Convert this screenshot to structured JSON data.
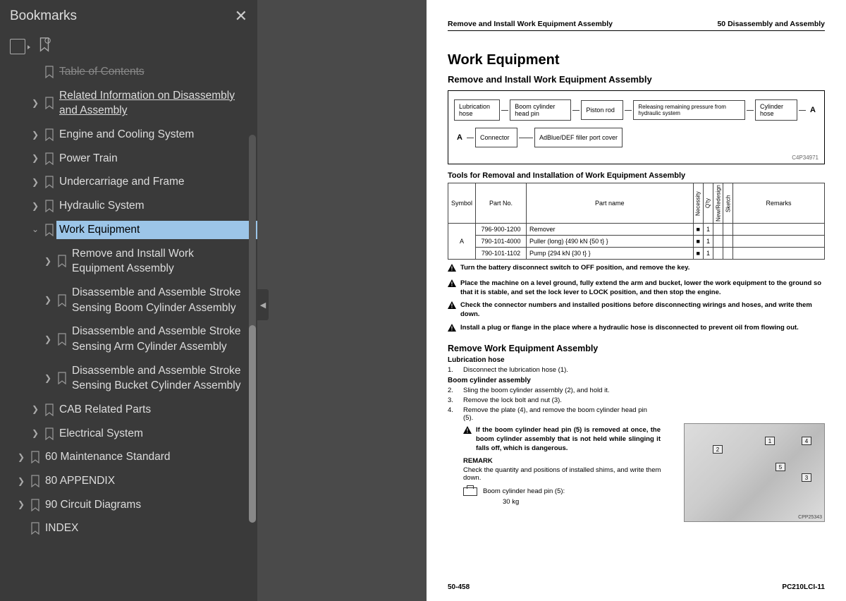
{
  "sidebar": {
    "title": "Bookmarks",
    "items": [
      {
        "txt": "Table of Contents",
        "lvl": 2,
        "chev": "",
        "style": "cut"
      },
      {
        "txt": "Related Information on Disassembly and Assembly",
        "lvl": 2,
        "chev": "r",
        "style": "under",
        "multi": true
      },
      {
        "txt": "Engine and Cooling System",
        "lvl": 2,
        "chev": "r"
      },
      {
        "txt": "Power Train",
        "lvl": 2,
        "chev": "r"
      },
      {
        "txt": "Undercarriage and Frame",
        "lvl": 2,
        "chev": "r"
      },
      {
        "txt": "Hydraulic System",
        "lvl": 2,
        "chev": "r"
      },
      {
        "txt": "Work Equipment",
        "lvl": 2,
        "chev": "d",
        "style": "sel"
      },
      {
        "txt": "Remove and Install Work Equipment Assembly",
        "lvl": 3,
        "chev": "r",
        "multi": true
      },
      {
        "txt": "Disassemble and Assemble Stroke Sensing Boom Cylinder Assembly",
        "lvl": 3,
        "chev": "r",
        "multi": true
      },
      {
        "txt": "Disassemble and Assemble Stroke Sensing Arm Cylinder Assembly",
        "lvl": 3,
        "chev": "r",
        "multi": true
      },
      {
        "txt": "Disassemble and Assemble Stroke Sensing Bucket Cylinder Assembly",
        "lvl": 3,
        "chev": "r",
        "multi": true
      },
      {
        "txt": "CAB Related Parts",
        "lvl": 2,
        "chev": "r"
      },
      {
        "txt": "Electrical System",
        "lvl": 2,
        "chev": "r"
      },
      {
        "txt": "60 Maintenance Standard",
        "lvl": 1,
        "chev": "r"
      },
      {
        "txt": "80 APPENDIX",
        "lvl": 1,
        "chev": "r"
      },
      {
        "txt": "90 Circuit Diagrams",
        "lvl": 1,
        "chev": "r"
      },
      {
        "txt": "INDEX",
        "lvl": 1,
        "chev": ""
      }
    ]
  },
  "page": {
    "hdr_l": "Remove and Install Work Equipment Assembly",
    "hdr_r": "50 Disassembly and Assembly",
    "h1": "Work Equipment",
    "h2": "Remove and Install Work Equipment Assembly",
    "diag": {
      "r1": [
        "Lubrication hose",
        "Boom cylinder head pin",
        "Piston rod",
        "Releasing remaining pressure from hydraulic system",
        "Cylinder hose"
      ],
      "r2": [
        "Connector",
        "AdBlue/DEF filler port cover"
      ],
      "code": "C4P34971"
    },
    "h3": "Tools for Removal and Installation of Work Equipment Assembly",
    "thead": [
      "Symbol",
      "Part No.",
      "Part name",
      "Necessity",
      "Q'ty",
      "New/Redesign",
      "Sketch",
      "Remarks"
    ],
    "trows": [
      {
        "sym": "",
        "pn": "796-900-1200",
        "name": "Remover",
        "nec": "■",
        "qty": "1"
      },
      {
        "sym": "A",
        "pn": "790-101-4000",
        "name": "Puller (long) {490 kN {50 t} }",
        "nec": "■",
        "qty": "1"
      },
      {
        "sym": "",
        "pn": "790-101-1102",
        "name": "Pump {294 kN {30 t} }",
        "nec": "■",
        "qty": "1"
      }
    ],
    "warns": [
      "Turn the battery disconnect switch to OFF position, and remove the key.",
      "Place the machine on a level ground, fully extend the arm and bucket, lower the work equipment to the ground so that it is stable, and set the lock lever to LOCK position, and then stop the engine.",
      "Check the connector numbers and installed positions before disconnecting wirings and hoses, and write them down.",
      "Install a plug or flange in the place where a hydraulic hose is disconnected to prevent oil from flowing out."
    ],
    "h4": "Remove Work Equipment Assembly",
    "sec1": {
      "t": "Lubrication hose",
      "s1": "Disconnect the lubrication hose (1)."
    },
    "sec2": {
      "t": "Boom cylinder assembly",
      "s2": "Sling the boom cylinder assembly (2), and hold it.",
      "s3": "Remove the lock bolt and nut (3).",
      "s4": "Remove the plate (4), and remove the boom cylinder head pin (5).",
      "warn": "If the boom cylinder head pin (5) is removed at once, the boom cylinder assembly that is not held while slinging it falls off, which is dangerous.",
      "remark": "REMARK",
      "rtxt": "Check the quantity and positions of installed shims, and write them down.",
      "wlabel": "Boom cylinder head pin (5):",
      "wval": "30 kg"
    },
    "photo_code": "CPP25343",
    "ftr_l": "50-458",
    "ftr_r": "PC210LCI-11"
  }
}
